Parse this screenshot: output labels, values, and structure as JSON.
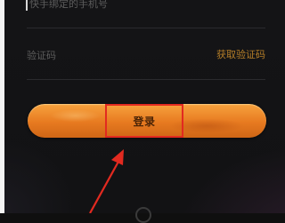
{
  "form": {
    "phone_placeholder": "快手绑定的手机号",
    "code_placeholder": "验证码",
    "get_code_label": "获取验证码",
    "login_label": "登录"
  },
  "colors": {
    "background": "#121214",
    "button_orange": "#ee8a2c",
    "get_code_text": "#b57e28",
    "annotation_red": "#e22a20"
  }
}
